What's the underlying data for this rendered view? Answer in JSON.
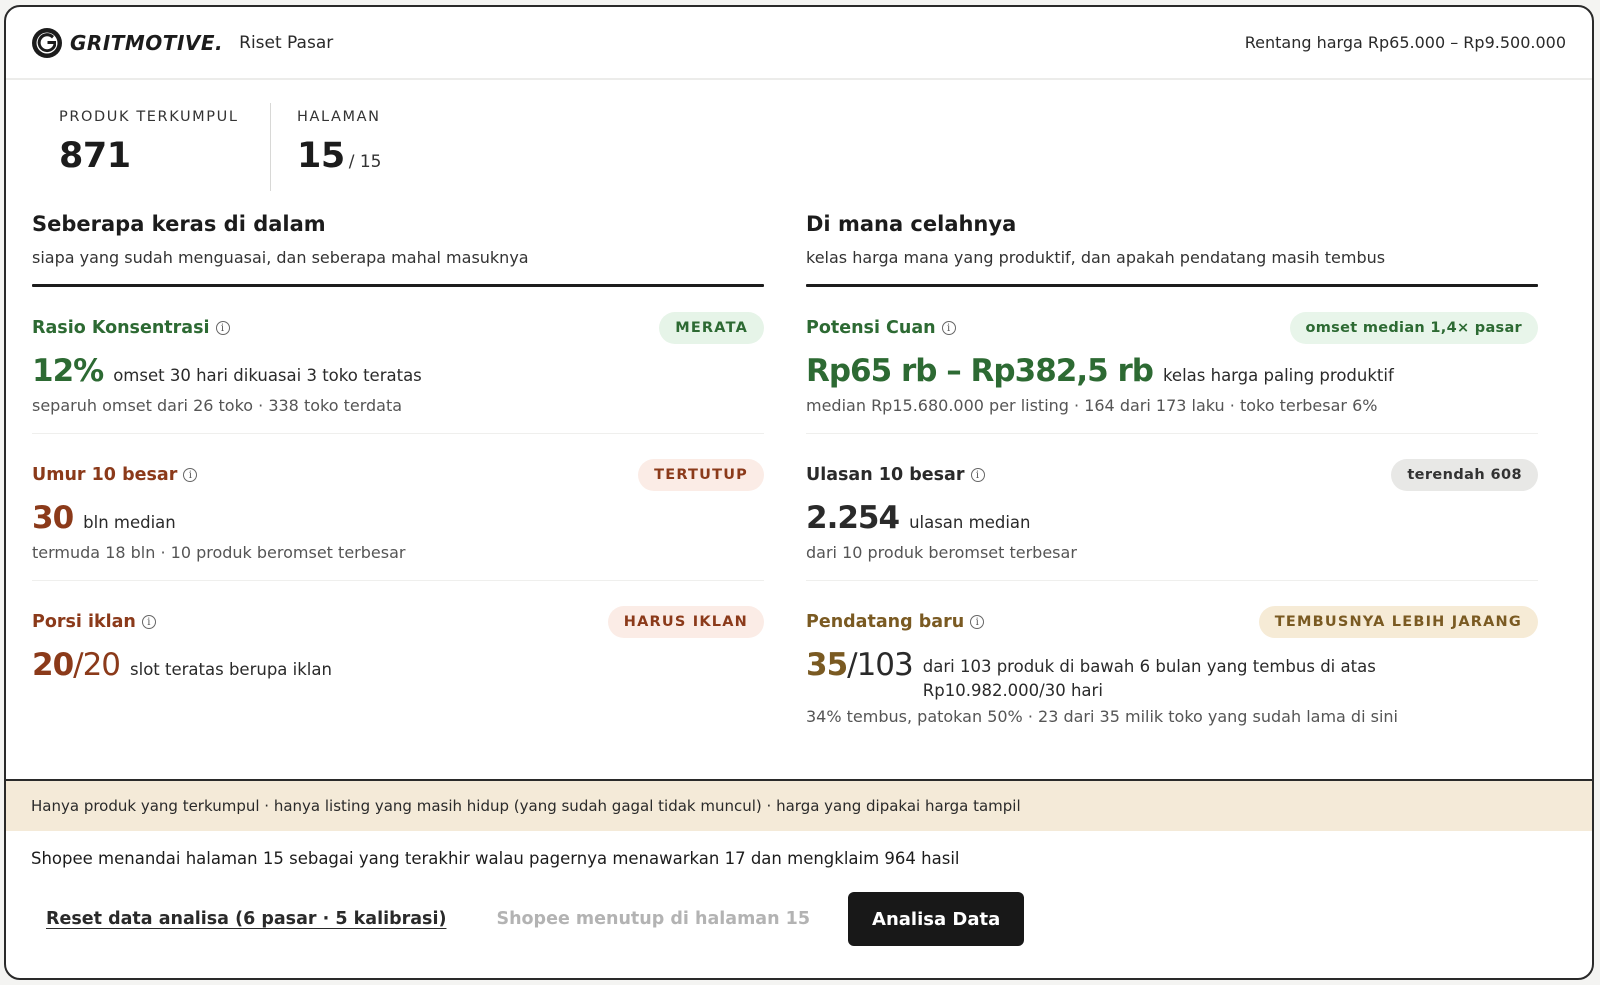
{
  "header": {
    "brand_name": "GRITMOTIVE.",
    "brand_sub": "Riset Pasar",
    "price_range": "Rentang harga Rp65.000 – Rp9.500.000"
  },
  "stats": {
    "collected_label": "PRODUK TERKUMPUL",
    "collected_value": "871",
    "pages_label": "HALAMAN",
    "pages_value": "15",
    "pages_total": "/ 15"
  },
  "left": {
    "title": "Seberapa keras di dalam",
    "subtitle": "siapa yang sudah menguasai, dan seberapa mahal masuknya",
    "metrics": [
      {
        "label": "Rasio Konsentrasi",
        "badge": "MERATA",
        "value": "12%",
        "desc": "omset 30 hari dikuasai 3 toko teratas",
        "note": "separuh omset dari 26 toko · 338 toko terdata"
      },
      {
        "label": "Umur 10 besar",
        "badge": "TERTUTUP",
        "value": "30",
        "desc": "bln median",
        "note": "termuda 18 bln · 10 produk beromset terbesar"
      },
      {
        "label": "Porsi iklan",
        "badge": "HARUS IKLAN",
        "value": "20",
        "value_suffix": "/20",
        "desc": "slot teratas berupa iklan",
        "note": ""
      }
    ]
  },
  "right": {
    "title": "Di mana celahnya",
    "subtitle": "kelas harga mana yang produktif, dan apakah pendatang masih tembus",
    "metrics": [
      {
        "label": "Potensi Cuan",
        "badge": "omset median 1,4× pasar",
        "value": "Rp65 rb – Rp382,5 rb",
        "desc": "kelas harga paling produktif",
        "note": "median Rp15.680.000 per listing · 164 dari 173 laku · toko terbesar 6%"
      },
      {
        "label": "Ulasan 10 besar",
        "badge": "terendah 608",
        "value": "2.254",
        "desc": "ulasan median",
        "note": "dari 10 produk beromset terbesar"
      },
      {
        "label": "Pendatang baru",
        "badge": "TEMBUSNYA LEBIH JARANG",
        "value": "35",
        "value_suffix": "/103",
        "desc": "dari 103 produk di bawah 6 bulan yang tembus di atas Rp10.982.000/30 hari",
        "note": "34% tembus, patokan 50% · 23 dari 35 milik toko yang sudah lama di sini"
      }
    ]
  },
  "footer": {
    "notice": "Hanya produk yang terkumpul · hanya listing yang masih hidup (yang sudah gagal tidak muncul) · harga yang dipakai harga tampil",
    "shopee_note": "Shopee menandai halaman 15 sebagai yang terakhir walau pagernya menawarkan 17 dan mengklaim 964 hasil",
    "reset_label": "Reset data analisa (6 pasar · 5 kalibrasi)",
    "closed_text": "Shopee menutup di halaman 15",
    "analyze_label": "Analisa Data"
  },
  "icons": {
    "brand": "gritmotive-logo-icon",
    "info": "info-icon"
  },
  "colors": {
    "green": "#2d6a33",
    "rust": "#8b3a1a",
    "olive": "#7a5a22",
    "notice_bg": "#f4ead8",
    "button_bg": "#181818"
  }
}
